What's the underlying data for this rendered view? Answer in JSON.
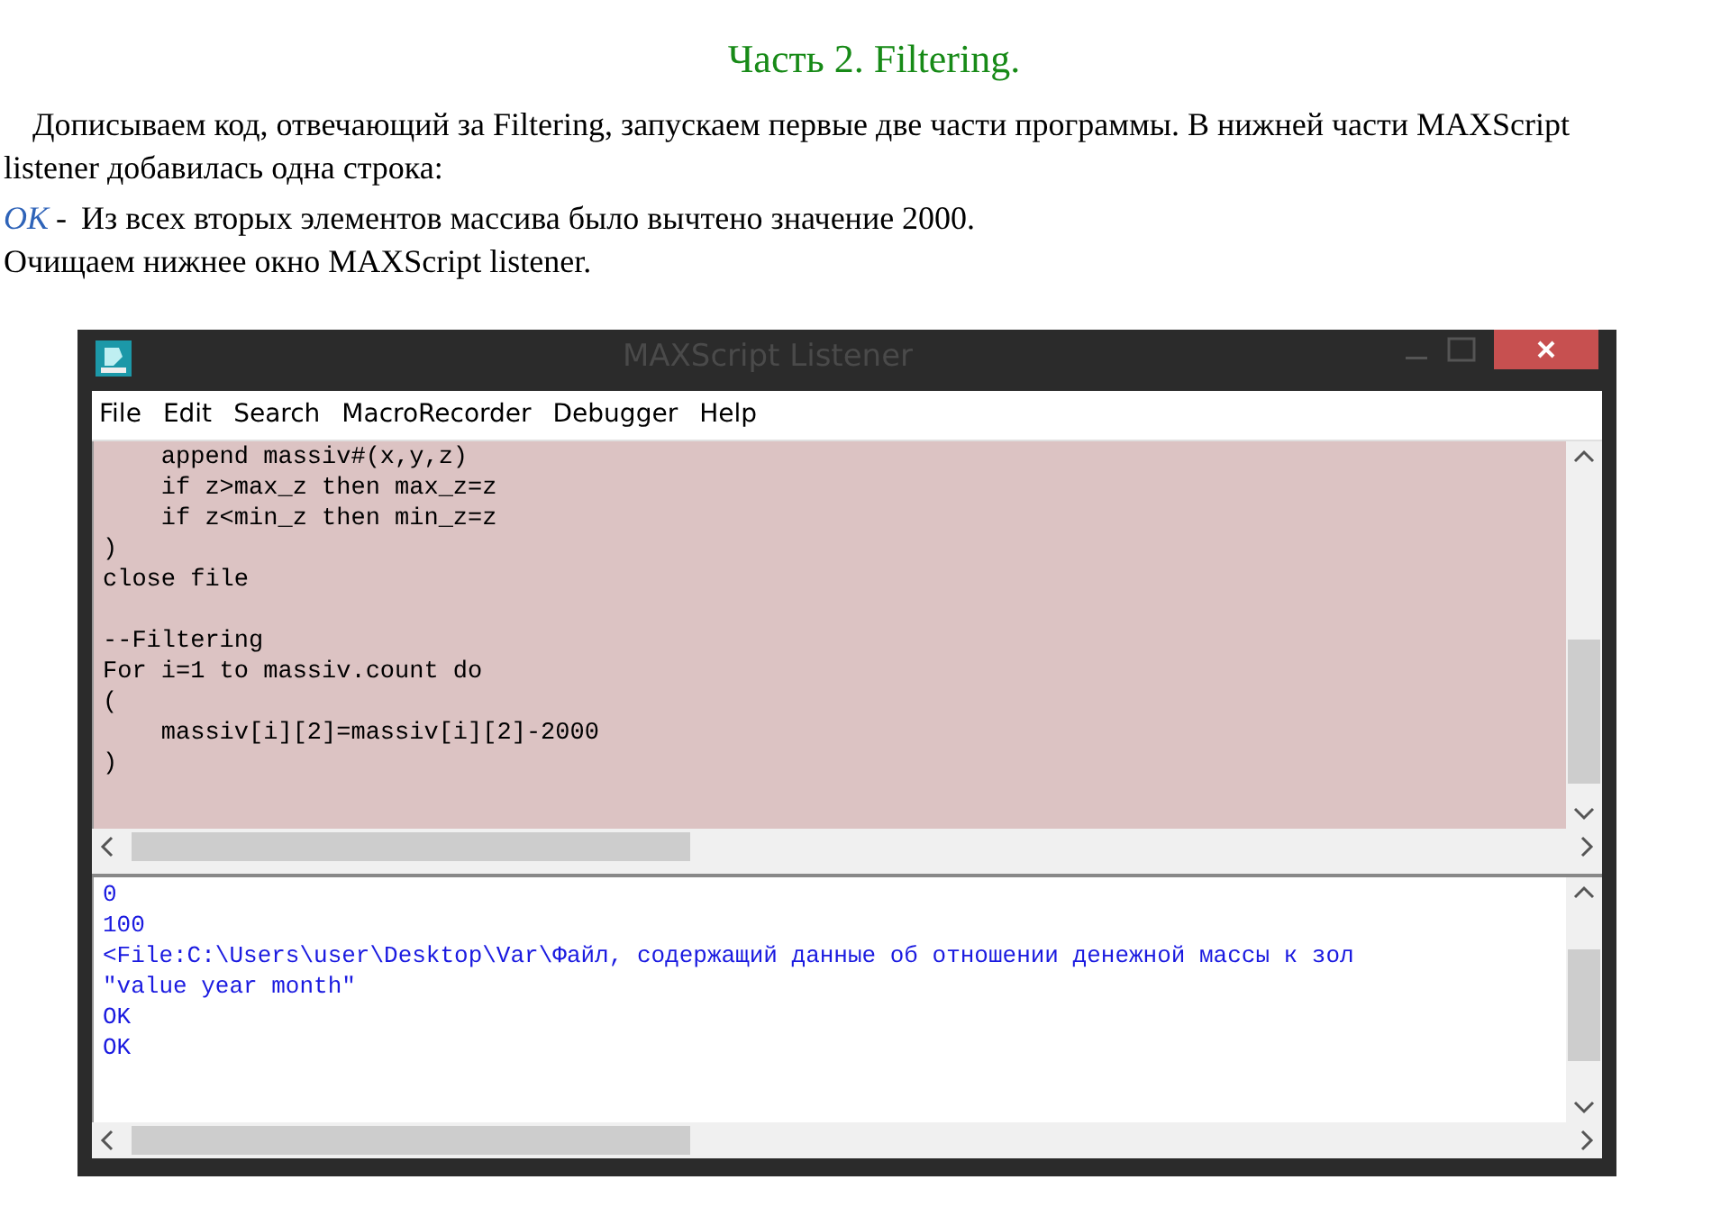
{
  "heading": "Часть 2. Filtering.",
  "paragraphs": [
    "Дописываем код, отвечающий за Filtering, запускаем первые две части программы. В нижней части MAXScript listener добавилась одна строка:"
  ],
  "result": {
    "label": "OK",
    "separator": "-",
    "text": "Из всех вторых элементов массива было вычтено значение 2000."
  },
  "note": "Очищаем нижнее окно MAXScript listener.",
  "window": {
    "title": "MAXScript Listener",
    "menu": [
      "File",
      "Edit",
      "Search",
      "MacroRecorder",
      "Debugger",
      "Help"
    ],
    "code_blocks": [
      [
        "    append massiv#(x,y,z)",
        "    if z>max_z then max_z=z",
        "    if z<min_z then min_z=z",
        ")",
        "close file"
      ],
      [
        "--Filtering",
        "For i=1 to massiv.count do",
        "(",
        "    massiv[i][2]=massiv[i][2]-2000",
        ")"
      ]
    ],
    "output_lines": [
      "0",
      "100",
      "<File:C:\\Users\\user\\Desktop\\Var\\Файл, содержащий данные об отношении денежной массы к зол",
      "\"value year month\"",
      "OK",
      "OK"
    ]
  }
}
